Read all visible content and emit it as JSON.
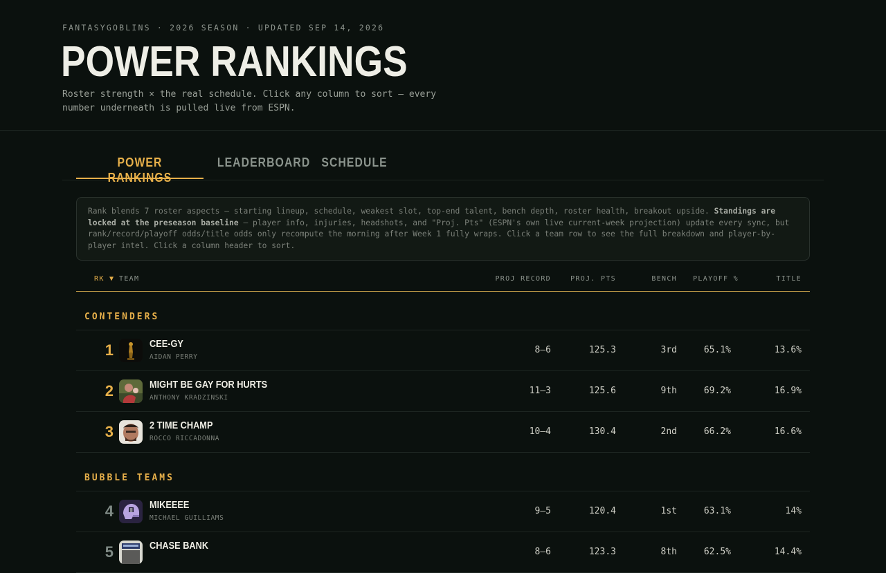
{
  "header": {
    "meta": "FANTASYGOBLINS · 2026 SEASON · UPDATED SEP 14, 2026",
    "title": "POWER RANKINGS",
    "subtitle": "Roster strength × the real schedule. Click any column to sort — every number underneath is pulled live from ESPN."
  },
  "tabs": [
    {
      "label": "POWER RANKINGS",
      "active": true
    },
    {
      "label": "LEADERBOARD",
      "active": false
    },
    {
      "label": "SCHEDULE",
      "active": false
    }
  ],
  "note": {
    "part1": "Rank blends 7 roster aspects — starting lineup, schedule, weakest slot, top-end talent, bench depth, roster health, breakout upside. ",
    "bold": "Standings are locked at the preseason baseline",
    "part2": " — player info, injuries, headshots, and \"Proj. Pts\" (ESPN's own live current-week projection) update every sync, but rank/record/playoff odds/title odds only recompute the morning after Week 1 fully wraps. Click a team row to see the full breakdown and player-by-player intel. Click a column header to sort."
  },
  "columns": {
    "rank": "RK ▼",
    "team": "TEAM",
    "proj_record": "PROJ RECORD",
    "proj_pts": "PROJ. PTS",
    "bench": "BENCH",
    "playoff": "PLAYOFF %",
    "title": "TITLE"
  },
  "groups": [
    {
      "label": "CONTENDERS",
      "rows": [
        {
          "rank": "1",
          "team": "CEE-GY",
          "owner": "AIDAN PERRY",
          "record": "8–6",
          "pts": "125.3",
          "bench": "3rd",
          "playoff": "65.1%",
          "title": "13.6%"
        },
        {
          "rank": "2",
          "team": "MIGHT BE GAY FOR HURTS",
          "owner": "ANTHONY KRADZINSKI",
          "record": "11–3",
          "pts": "125.6",
          "bench": "9th",
          "playoff": "69.2%",
          "title": "16.9%"
        },
        {
          "rank": "3",
          "team": "2 TIME CHAMP",
          "owner": "ROCCO RICCADONNA",
          "record": "10–4",
          "pts": "130.4",
          "bench": "2nd",
          "playoff": "66.2%",
          "title": "16.6%"
        }
      ]
    },
    {
      "label": "BUBBLE TEAMS",
      "rows": [
        {
          "rank": "4",
          "team": "MIKEEEE",
          "owner": "MICHAEL GUILLIAMS",
          "record": "9–5",
          "pts": "120.4",
          "bench": "1st",
          "playoff": "63.1%",
          "title": "14%"
        },
        {
          "rank": "5",
          "team": "CHASE BANK",
          "owner": "",
          "record": "8–6",
          "pts": "123.3",
          "bench": "8th",
          "playoff": "62.5%",
          "title": "14.4%"
        }
      ]
    }
  ],
  "colors": {
    "accent": "#e7b04a",
    "background": "#0b110e",
    "rank_muted": "#7f8a85"
  }
}
